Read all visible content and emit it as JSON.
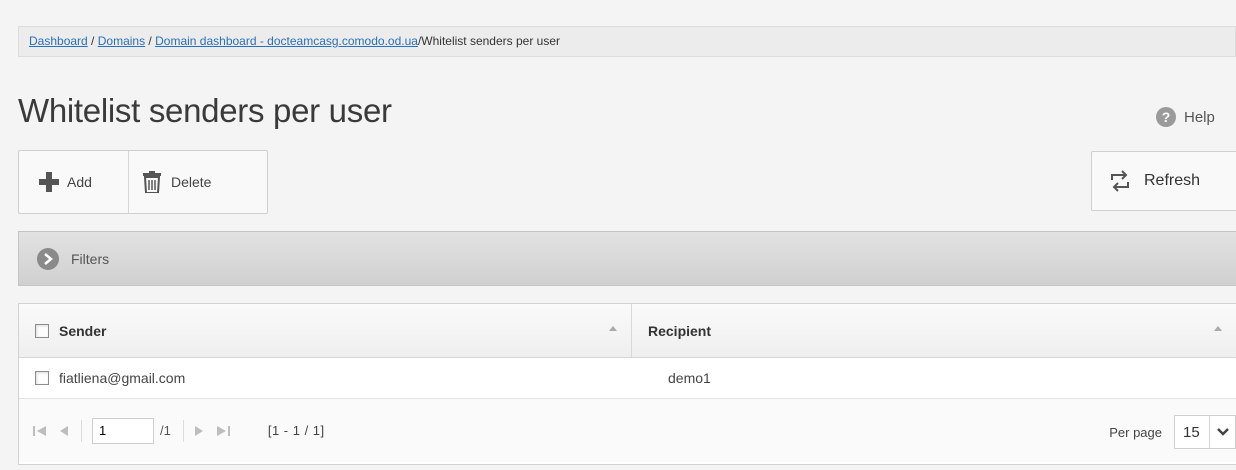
{
  "breadcrumb": {
    "items": [
      {
        "label": "Dashboard"
      },
      {
        "label": "Domains"
      },
      {
        "label": "Domain dashboard - docteamcasg.comodo.od.ua"
      }
    ],
    "current": "/Whitelist senders per user"
  },
  "page": {
    "title": "Whitelist senders per user"
  },
  "help": {
    "label": "Help"
  },
  "toolbar": {
    "add_label": "Add",
    "delete_label": "Delete",
    "refresh_label": "Refresh"
  },
  "filters": {
    "label": "Filters"
  },
  "table": {
    "columns": [
      "Sender",
      "Recipient"
    ],
    "rows": [
      {
        "sender": "fiatliena@gmail.com",
        "recipient": "demo1"
      }
    ]
  },
  "pager": {
    "page_value": "1",
    "of_text": "/1",
    "range_text": "[1 - 1 / 1]",
    "per_page_label": "Per page",
    "per_page_value": "15"
  },
  "colors": {
    "link": "#2a6fb8",
    "background": "#f4f4f4",
    "filters_bar": "#d6d6d6"
  }
}
